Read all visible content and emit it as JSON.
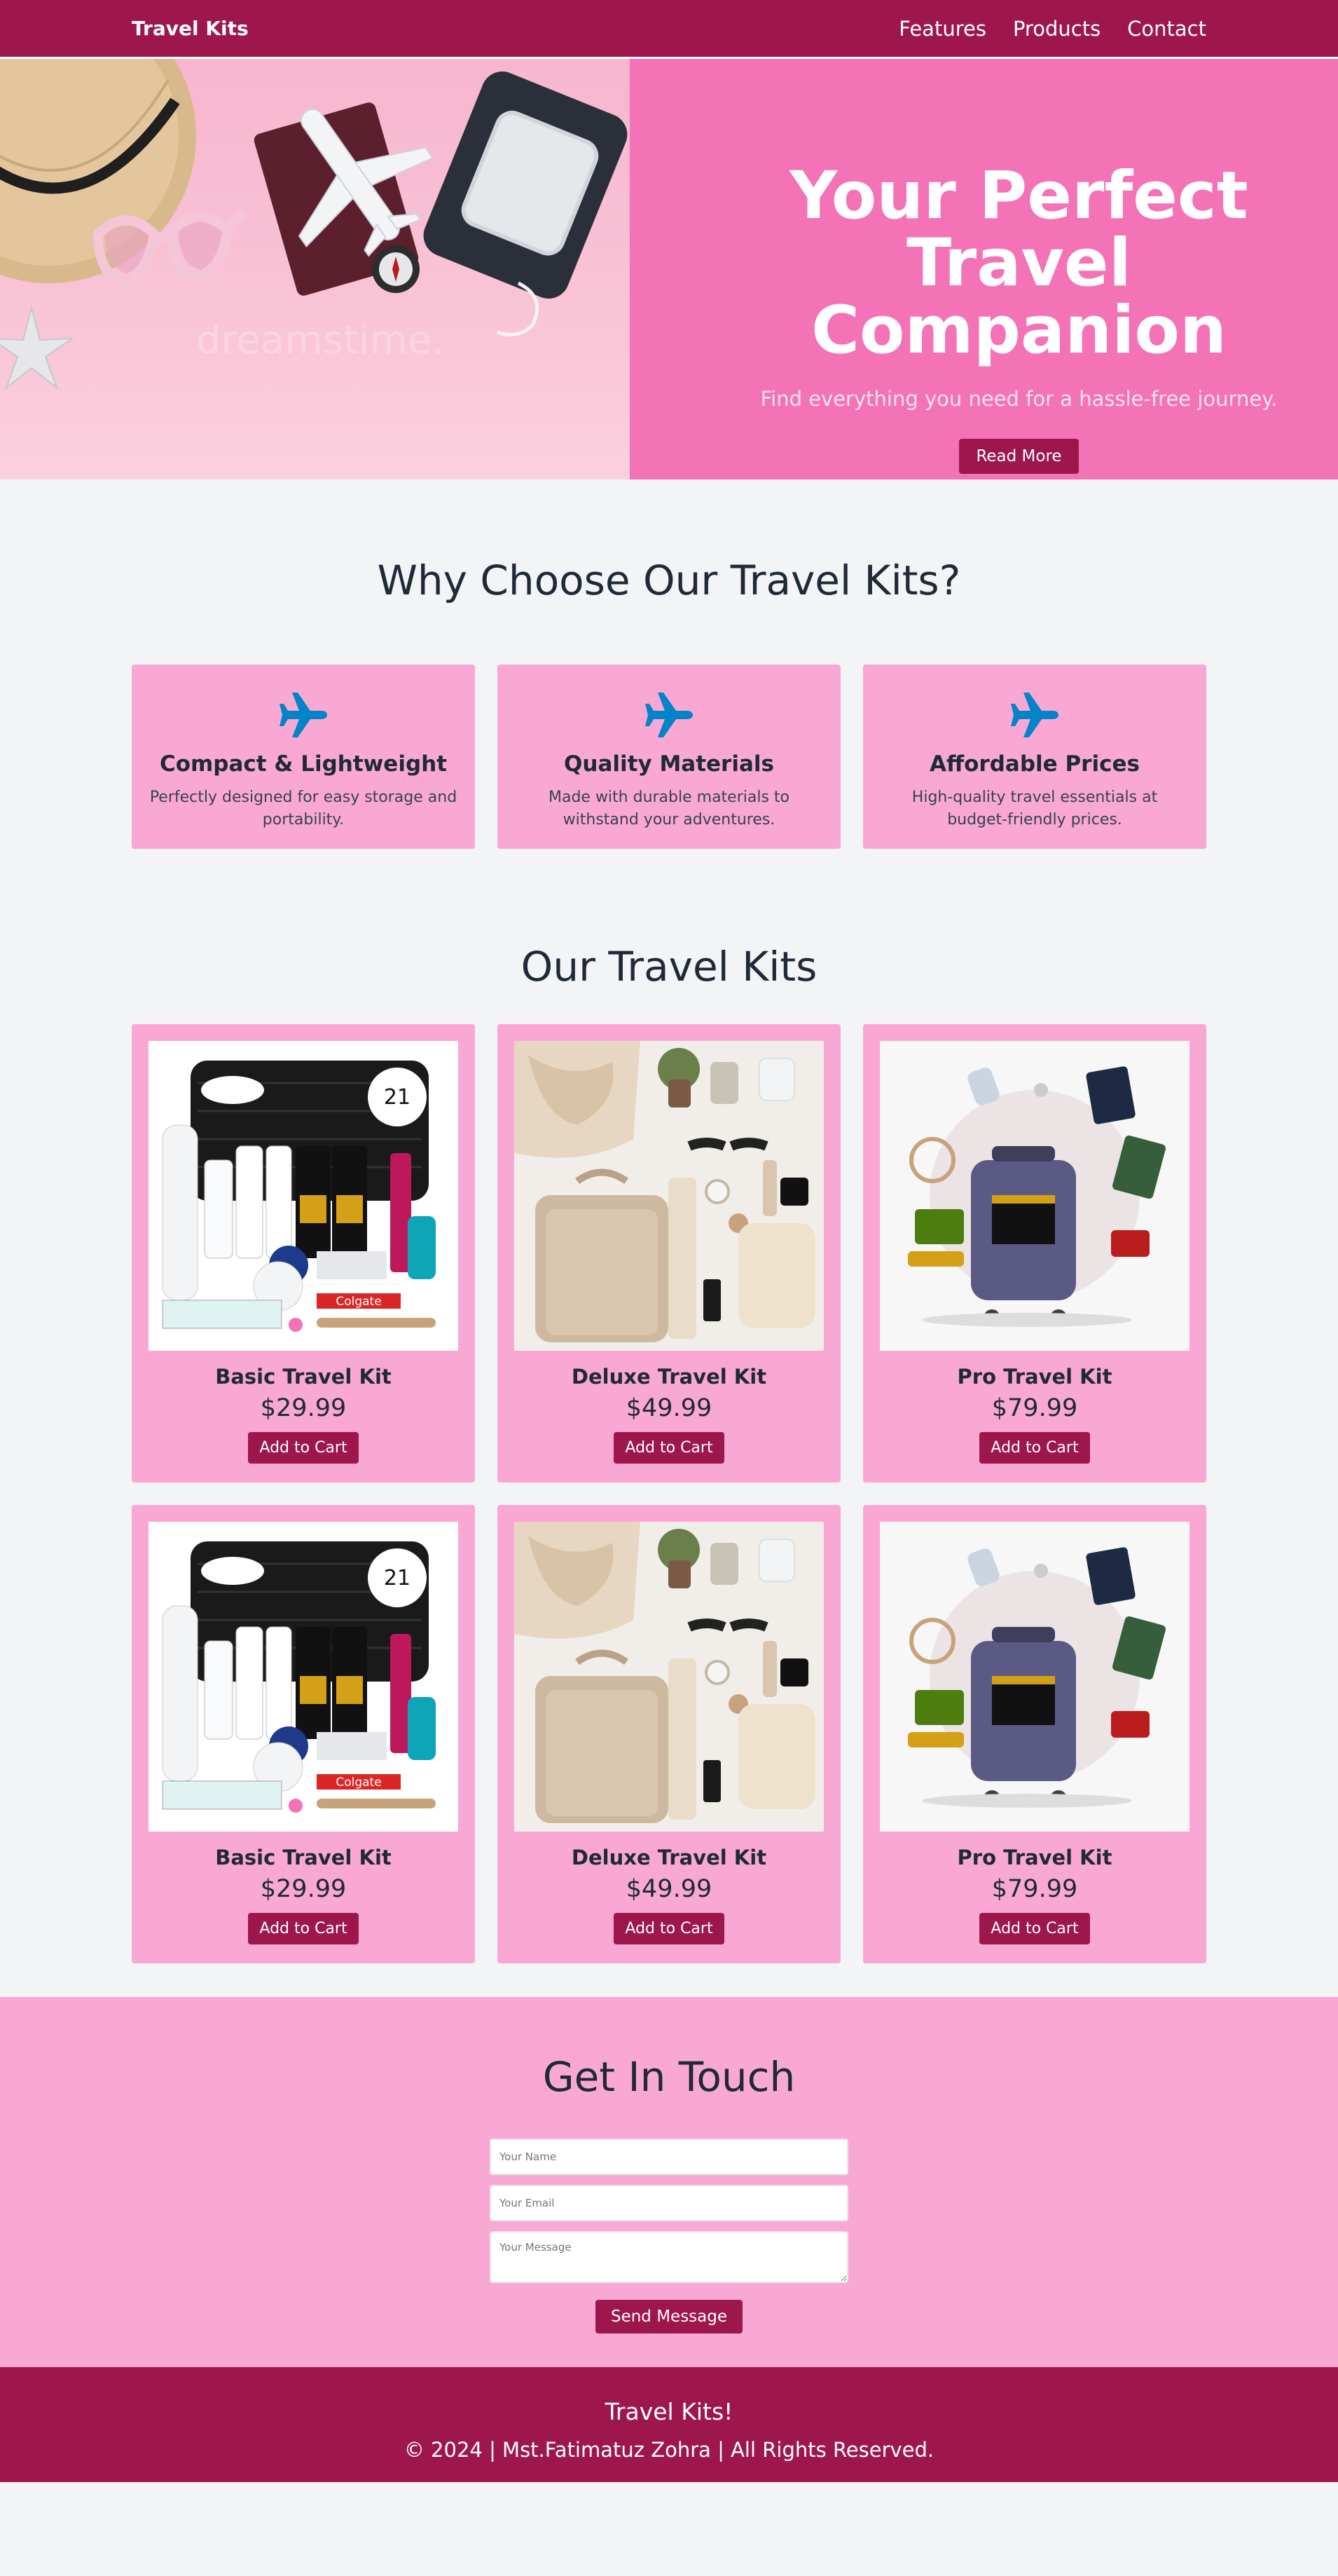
{
  "nav": {
    "brand": "Travel Kits",
    "links": [
      "Features",
      "Products",
      "Contact"
    ]
  },
  "hero": {
    "title_line1": "Your Perfect",
    "title_line2": "Travel Companion",
    "subtitle": "Find everything you need for a hassle-free journey.",
    "button": "Read More",
    "watermark": "dreamstime."
  },
  "features": {
    "title": "Why Choose Our Travel Kits?",
    "items": [
      {
        "title": "Compact & Lightweight",
        "desc": "Perfectly designed for easy storage and portability.",
        "icon": "airplane-icon"
      },
      {
        "title": "Quality Materials",
        "desc": "Made with durable materials to withstand your adventures.",
        "icon": "airplane-icon"
      },
      {
        "title": "Affordable Prices",
        "desc": "High-quality travel essentials at budget-friendly prices.",
        "icon": "airplane-icon"
      }
    ]
  },
  "products": {
    "title": "Our Travel Kits",
    "items": [
      {
        "name": "Basic Travel Kit",
        "price": "$29.99",
        "button": "Add to Cart"
      },
      {
        "name": "Deluxe Travel Kit",
        "price": "$49.99",
        "button": "Add to Cart"
      },
      {
        "name": "Pro Travel Kit",
        "price": "$79.99",
        "button": "Add to Cart"
      },
      {
        "name": "Basic Travel Kit",
        "price": "$29.99",
        "button": "Add to Cart"
      },
      {
        "name": "Deluxe Travel Kit",
        "price": "$49.99",
        "button": "Add to Cart"
      },
      {
        "name": "Pro Travel Kit",
        "price": "$79.99",
        "button": "Add to Cart"
      }
    ]
  },
  "contact": {
    "title": "Get In Touch",
    "name_placeholder": "Your Name",
    "email_placeholder": "Your Email",
    "message_placeholder": "Your Message",
    "button": "Send Message"
  },
  "footer": {
    "title": "Travel Kits!",
    "copyright": "© 2024 | Mst.Fatimatuz Zohra | All Rights Reserved."
  },
  "colors": {
    "primary": "#9d174d",
    "hero_pink": "#f472b6",
    "card_pink": "#f9a8d4",
    "icon_blue": "#0284c7",
    "page_bg": "#f3f4f6"
  }
}
